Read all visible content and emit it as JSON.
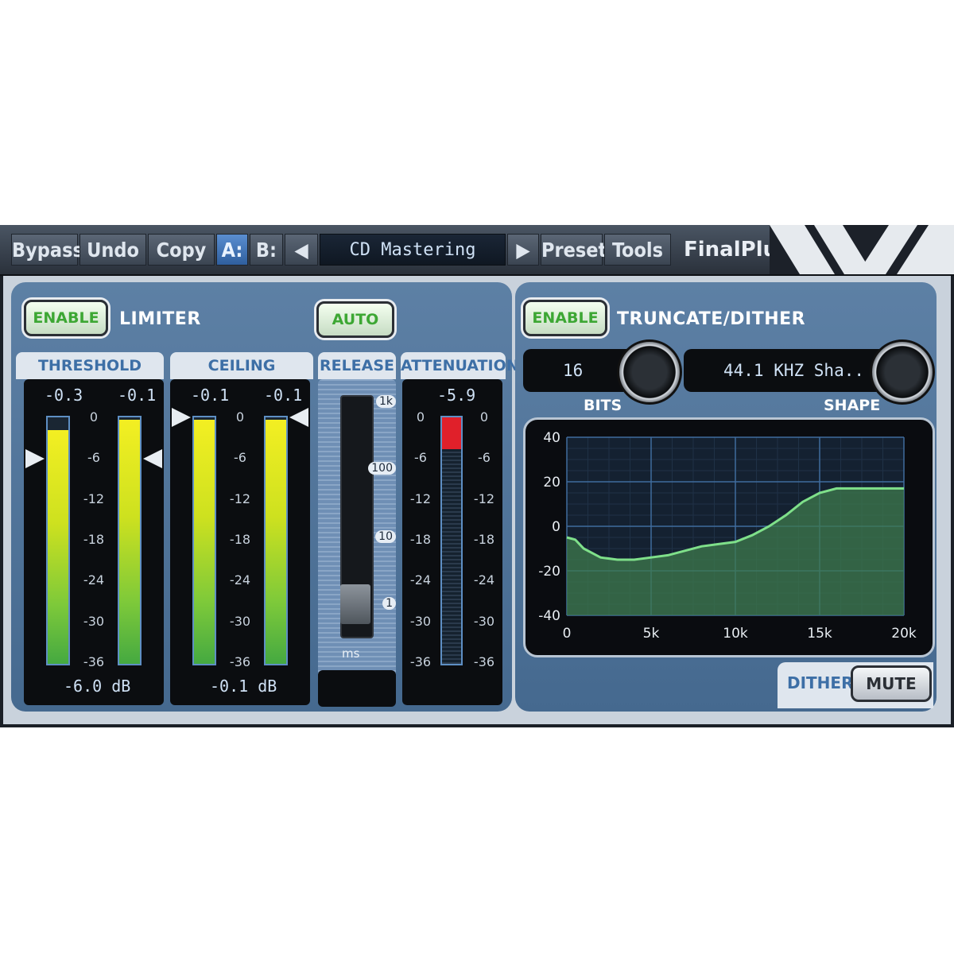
{
  "toolbar": {
    "bypass": "Bypass",
    "undo": "Undo",
    "copy": "Copy",
    "a": "A:",
    "b": "B:",
    "prev_icon": "left-triangle-icon",
    "preset_name": "CD Mastering",
    "next_icon": "right-triangle-icon",
    "preset": "Preset",
    "tools": "Tools",
    "brand": "FinalPlug"
  },
  "limiter": {
    "enable_label": "ENABLE",
    "title": "LIMITER",
    "auto_label": "AUTO",
    "threshold": {
      "heading": "THRESHOLD",
      "peak_left": "-0.3",
      "peak_right": "-0.1",
      "value": "-6.0 dB",
      "level_left": 0.95,
      "level_right": 0.99
    },
    "ceiling": {
      "heading": "CEILING",
      "peak_left": "-0.1",
      "peak_right": "-0.1",
      "value": "-0.1 dB",
      "level_left": 0.99,
      "level_right": 0.99
    },
    "release": {
      "heading": "RELEASE",
      "ticks": [
        "1k",
        "100",
        "10",
        "1"
      ],
      "unit": "ms"
    },
    "attenuation": {
      "heading": "ATTENUATION",
      "value": "-5.9"
    },
    "scale": [
      "0",
      "-6",
      "-12",
      "-18",
      "-24",
      "-30",
      "-36"
    ]
  },
  "dither": {
    "enable_label": "ENABLE",
    "title": "TRUNCATE/DITHER",
    "bits_value": "16",
    "bits_label": "BITS",
    "shape_value": "44.1 KHZ Sha..",
    "shape_label": "SHAPE",
    "dither_label": "DITHER",
    "mute_label": "MUTE"
  },
  "colors": {
    "accent_green": "#3da734",
    "panel_blue": "#5d80a5",
    "meter_yellow": "#f3ef22",
    "atten_red": "#e0202a",
    "curve_green": "#7fe08a"
  },
  "chart_data": {
    "type": "area",
    "x": [
      0,
      500,
      1000,
      2000,
      3000,
      4000,
      5000,
      6000,
      7000,
      8000,
      9000,
      10000,
      11000,
      12000,
      13000,
      14000,
      15000,
      16000,
      17000,
      18000,
      19000,
      20000
    ],
    "y": [
      -5,
      -6,
      -10,
      -14,
      -15,
      -15,
      -14,
      -13,
      -11,
      -9,
      -8,
      -7,
      -4,
      0,
      5,
      11,
      15,
      17,
      17,
      17,
      17,
      17
    ],
    "x_ticks": [
      "0",
      "5k",
      "10k",
      "15k",
      "20k"
    ],
    "y_ticks": [
      "40",
      "20",
      "0",
      "-20",
      "-40"
    ],
    "xlim": [
      0,
      20000
    ],
    "ylim": [
      -40,
      40
    ],
    "grid": true
  }
}
